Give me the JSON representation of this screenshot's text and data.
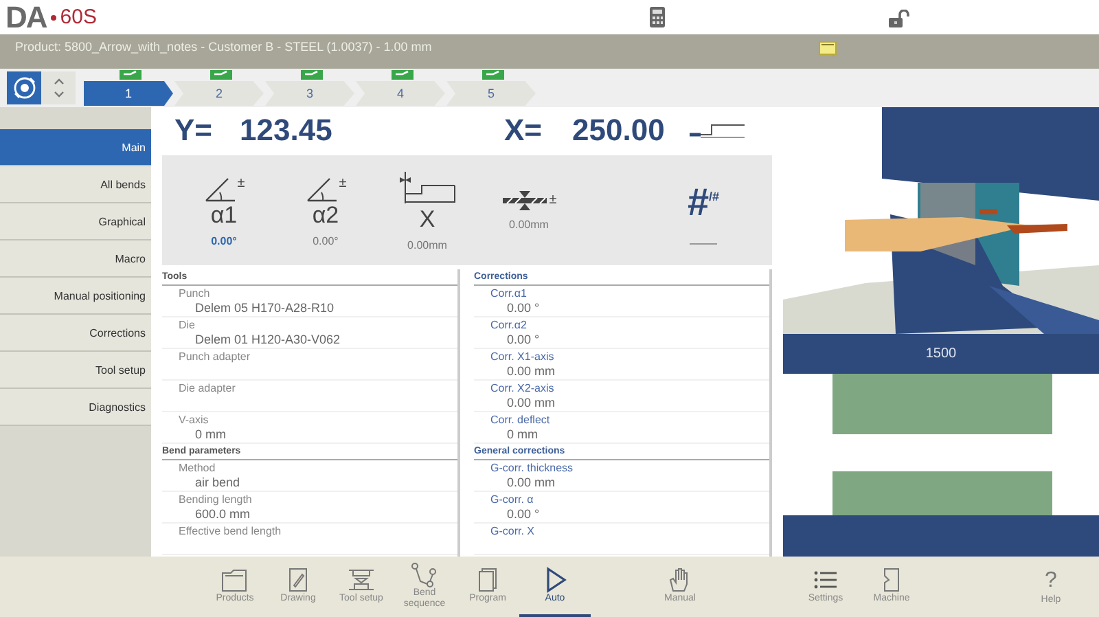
{
  "logo": {
    "brand": "DA",
    "model": "60S"
  },
  "product_bar": {
    "title": "Product: 5800_Arrow_with_notes - Customer B - STEEL (1.0037) - 1.00 mm"
  },
  "steps": [
    {
      "label": "1",
      "selected": true
    },
    {
      "label": "2",
      "selected": false
    },
    {
      "label": "3",
      "selected": false
    },
    {
      "label": "4",
      "selected": false
    },
    {
      "label": "5",
      "selected": false
    }
  ],
  "sidebar": {
    "items": [
      {
        "label": "Main",
        "selected": true
      },
      {
        "label": "All bends",
        "selected": false
      },
      {
        "label": "Graphical",
        "selected": false
      },
      {
        "label": "Macro",
        "selected": false
      },
      {
        "label": "Manual positioning",
        "selected": false
      },
      {
        "label": "Corrections",
        "selected": false
      },
      {
        "label": "Tool setup",
        "selected": false
      },
      {
        "label": "Diagnostics",
        "selected": false
      }
    ]
  },
  "readout": [
    {
      "axis": "Y=",
      "value": "123.45"
    },
    {
      "axis": "X=",
      "value": "250.00"
    }
  ],
  "parameters": [
    {
      "kind": "angle",
      "modifier": "±",
      "symbol": "α1",
      "value": "0.00°",
      "selected": true
    },
    {
      "kind": "angle",
      "modifier": "±",
      "symbol": "α2",
      "value": "0.00°",
      "selected": false
    },
    {
      "kind": "x",
      "symbol": "X",
      "value": "0.00mm",
      "selected": false
    },
    {
      "kind": "crowning",
      "modifier": "±",
      "value": "0.00mm",
      "selected": false
    },
    {
      "kind": "count",
      "symbol": "#$^{/#}$"
    }
  ],
  "left_sections": [
    {
      "title": "Tools",
      "rows": [
        {
          "label": "Punch",
          "value": "Delem 05 H170-A28-R10"
        },
        {
          "label": "Die",
          "value": "Delem 01 H120-A30-V062"
        },
        {
          "label": "Punch adapter"
        },
        {
          "label": "Die adapter"
        },
        {
          "label": "V-axis",
          "value": "0 mm"
        }
      ]
    },
    {
      "title": "Bend parameters",
      "rows": [
        {
          "label": "Method",
          "value": "air bend"
        },
        {
          "label": "Bending length",
          "value": "600.0 mm"
        },
        {
          "label": "Effective bend length"
        }
      ]
    }
  ],
  "right_sections": [
    {
      "title": "Corrections",
      "rows": [
        {
          "label": "Corr.α1",
          "value": "0.00 °"
        },
        {
          "label": "Corr.α2",
          "value": "0.00 °"
        },
        {
          "label": "Corr. X1-axis",
          "value": "0.00 mm"
        },
        {
          "label": "Corr. X2-axis",
          "value": "0.00 mm"
        },
        {
          "label": "Corr. deflect",
          "value": "0 mm"
        }
      ]
    },
    {
      "title": "General corrections",
      "rows": [
        {
          "label": "G-corr. thickness",
          "value": "0.00 mm"
        },
        {
          "label": "G-corr. α",
          "value": "0.00 °"
        },
        {
          "label": "G-corr. X"
        }
      ]
    }
  ],
  "tool_view": {
    "length": "1500"
  },
  "nav": [
    {
      "kind": "products",
      "label": "Products",
      "selected": false
    },
    {
      "kind": "drawing",
      "label": "Drawing",
      "selected": false
    },
    {
      "kind": "tools",
      "label": "Tool setup",
      "selected": false
    },
    {
      "kind": "sequence",
      "label": "Bend sequence",
      "selected": false
    },
    {
      "kind": "program",
      "label": "Program",
      "selected": false
    },
    {
      "kind": "auto",
      "label": "Auto",
      "selected": true
    },
    {
      "kind": "manual",
      "label": "Manual",
      "selected": false
    },
    {
      "kind": "settings",
      "label": "Settings",
      "selected": false
    },
    {
      "kind": "machine",
      "label": "Machine",
      "selected": false
    }
  ],
  "help": {
    "glyph": "?",
    "label": "Help"
  }
}
